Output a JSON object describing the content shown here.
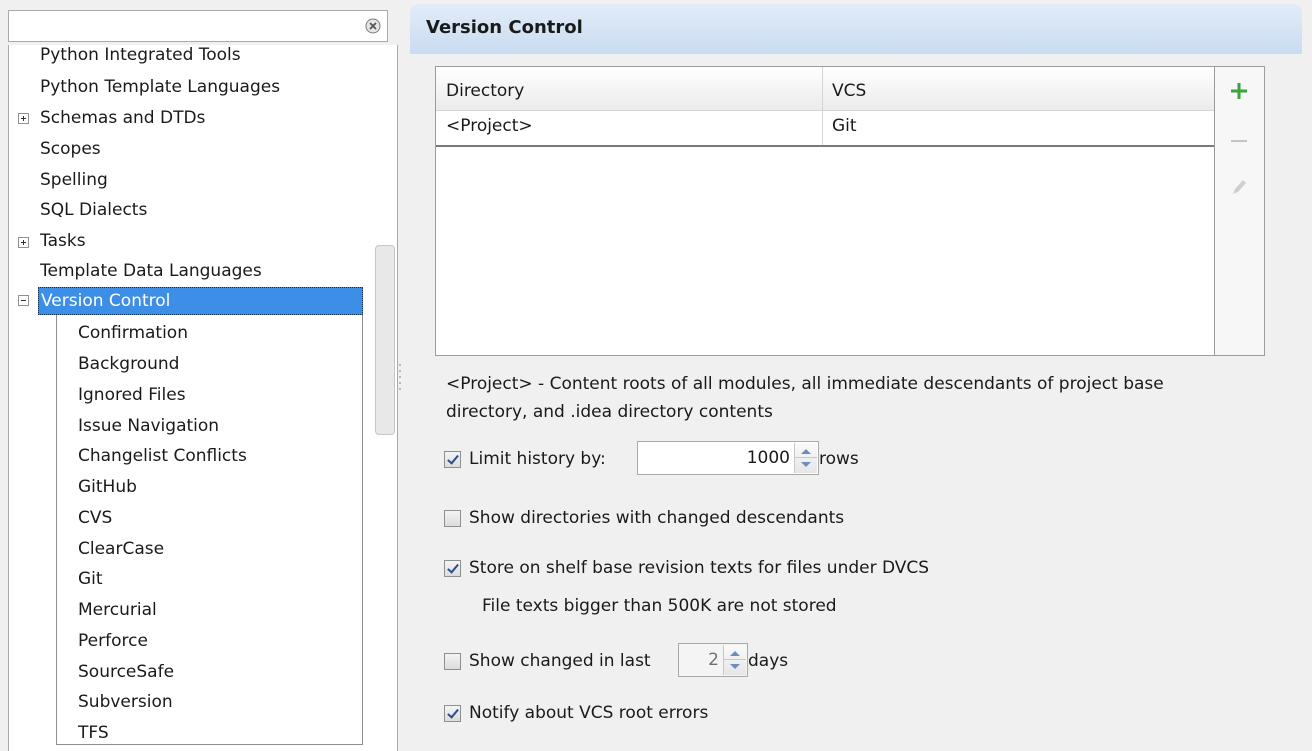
{
  "search": {
    "value": ""
  },
  "tree": {
    "items": [
      {
        "label": "Python Integrated Tools"
      },
      {
        "label": "Python Template Languages"
      },
      {
        "label": "Schemas and DTDs"
      },
      {
        "label": "Scopes"
      },
      {
        "label": "Spelling"
      },
      {
        "label": "SQL Dialects"
      },
      {
        "label": "Tasks"
      },
      {
        "label": "Template Data Languages"
      },
      {
        "label": "Version Control"
      }
    ],
    "children": [
      {
        "label": "Confirmation"
      },
      {
        "label": "Background"
      },
      {
        "label": "Ignored Files"
      },
      {
        "label": "Issue Navigation"
      },
      {
        "label": "Changelist Conflicts"
      },
      {
        "label": "GitHub"
      },
      {
        "label": "CVS"
      },
      {
        "label": "ClearCase"
      },
      {
        "label": "Git"
      },
      {
        "label": "Mercurial"
      },
      {
        "label": "Perforce"
      },
      {
        "label": "SourceSafe"
      },
      {
        "label": "Subversion"
      },
      {
        "label": "TFS"
      }
    ]
  },
  "panel": {
    "title": "Version Control",
    "table": {
      "columns": [
        "Directory",
        "VCS"
      ],
      "rows": [
        {
          "directory": "<Project>",
          "vcs": "Git"
        }
      ]
    },
    "toolbar": {
      "add_icon": "plus-icon",
      "remove_icon": "minus-icon",
      "edit_icon": "pencil-icon"
    },
    "description_line1": "<Project> - Content roots of all modules, all immediate descendants of project base",
    "description_line2": "directory, and .idea directory contents",
    "limit_history": {
      "label": "Limit history by:",
      "checked": true,
      "value": "1000",
      "unit": "rows"
    },
    "show_dirs": {
      "label": "Show directories with changed descendants",
      "checked": false
    },
    "store_shelf": {
      "label": "Store on shelf base revision texts for files under DVCS",
      "checked": true
    },
    "store_note": "File texts bigger than 500K are not stored",
    "show_changed": {
      "label": "Show changed in last",
      "checked": false,
      "value": "2",
      "unit": "days"
    },
    "notify": {
      "label": "Notify about VCS root errors",
      "checked": true
    }
  },
  "colors": {
    "selection": "#3d8ee6",
    "header": "#c9dcf1",
    "add_icon": "#3aa63a"
  }
}
